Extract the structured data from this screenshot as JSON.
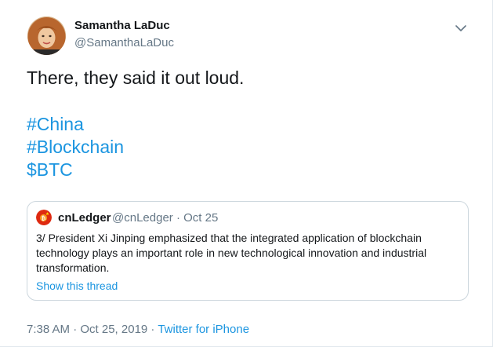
{
  "author": {
    "name": "Samantha LaDuc",
    "handle": "@SamanthaLaDuc"
  },
  "tweet": {
    "text": "There, they said it out loud.",
    "hashtags": [
      "#China",
      "#Blockchain",
      "$BTC"
    ]
  },
  "quoted_tweet": {
    "name": "cnLedger",
    "handle_date": "@cnLedger · Oct 25",
    "text_lines": [
      "3/ President Xi Jinping emphasized that the integrated application of blockchain",
      "technology plays an important role in new technological innovation and industrial",
      "transformation."
    ],
    "show_thread": "Show this thread"
  },
  "meta": {
    "timestamp": "7:38 AM · Oct 25, 2019",
    "separator": " · ",
    "source": "Twitter for iPhone"
  },
  "icons": {
    "menu": "chevron-down-icon",
    "quoted_avatar": "china-flag-bitcoin-icon"
  },
  "colors": {
    "link": "#1b95e0",
    "secondary_text": "#657786",
    "primary_text": "#14171a",
    "border": "#ccd6dd"
  }
}
